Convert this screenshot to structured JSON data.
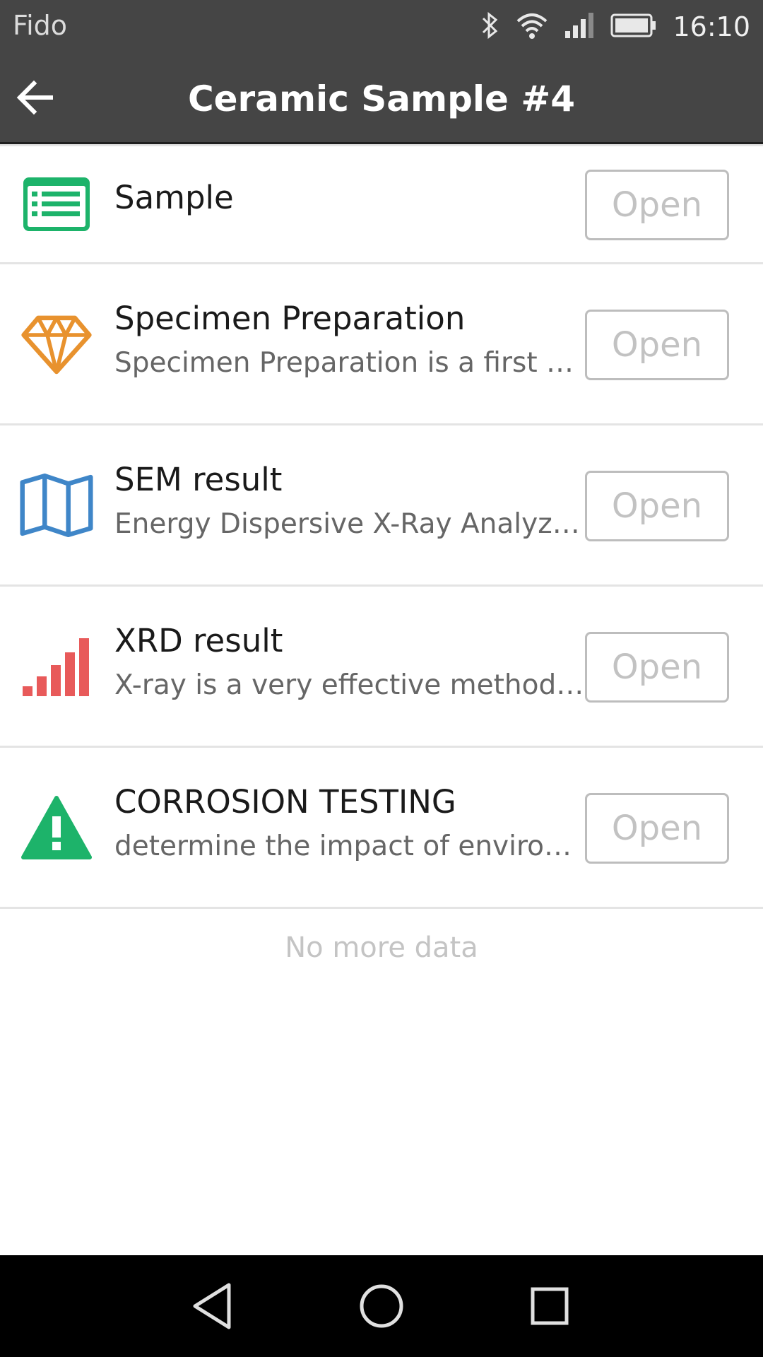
{
  "status_bar": {
    "carrier": "Fido",
    "time": "16:10",
    "icons": [
      "bluetooth-icon",
      "wifi-icon",
      "signal-icon",
      "battery-icon"
    ]
  },
  "app_bar": {
    "title": "Ceramic Sample #4",
    "back_icon": "arrow-back-icon"
  },
  "items": [
    {
      "title": "Sample",
      "description": "",
      "icon": "list-card-icon",
      "icon_color": "#1db36a",
      "button": "Open"
    },
    {
      "title": "Specimen Preparation",
      "description": "Specimen Preparation is a first an...",
      "icon": "diamond-icon",
      "icon_color": "#e8922e",
      "button": "Open"
    },
    {
      "title": "SEM result",
      "description": "Energy Dispersive X-Ray Analyzer r...",
      "icon": "map-icon",
      "icon_color": "#3f86c8",
      "button": "Open"
    },
    {
      "title": "XRD result",
      "description": "X-ray is a very effective method of ...",
      "icon": "bar-signal-icon",
      "icon_color": "#e85a5a",
      "button": "Open"
    },
    {
      "title": "CORROSION TESTING",
      "description": "determine the impact of environm...",
      "icon": "warning-icon",
      "icon_color": "#1db36a",
      "button": "Open"
    }
  ],
  "footer": {
    "no_more": "No more data"
  },
  "nav_bar": {
    "icons": [
      "back-triangle-icon",
      "home-circle-icon",
      "recents-square-icon"
    ]
  }
}
